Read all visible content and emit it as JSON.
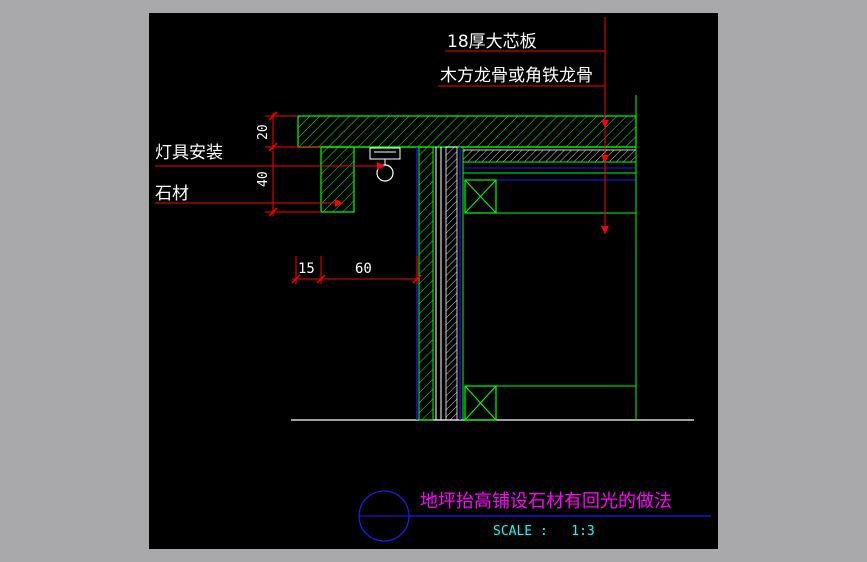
{
  "drawing": {
    "labels": {
      "board": "18厚大芯板",
      "keel": "木方龙骨或角铁龙骨",
      "light": "灯具安装",
      "stone": "石材"
    },
    "dimensions": {
      "d20": "20",
      "d40": "40",
      "d15": "15",
      "d60": "60"
    },
    "title": {
      "main": "地坪抬高铺设石材有回光的做法",
      "scale": "SCALE :   1:3"
    },
    "colors": {
      "canvas": "#000000",
      "frame": "#a9a9ab",
      "green": "#00ff00",
      "red": "#ff0000",
      "blue": "#1a1aff",
      "white": "#ffffff",
      "magenta": "#ff00ff",
      "cyan": "#00ffff"
    }
  }
}
